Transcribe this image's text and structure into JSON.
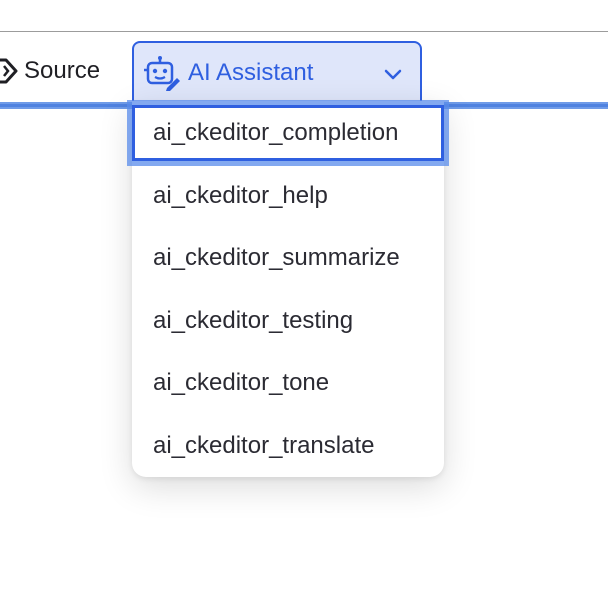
{
  "toolbar": {
    "source_label": "Source",
    "ai_assistant_label": "AI Assistant"
  },
  "icons": {
    "source": "source-code-icon",
    "ai": "robot-pencil-icon",
    "dropdown": "chevron-down-icon"
  },
  "colors": {
    "accent": "#2f5fe0",
    "accent_bg": "#dfe6fa",
    "focus_ring": "#6f9be8"
  },
  "menu": {
    "items": [
      {
        "label": "ai_ckeditor_completion",
        "active": true
      },
      {
        "label": "ai_ckeditor_help"
      },
      {
        "label": "ai_ckeditor_summarize"
      },
      {
        "label": "ai_ckeditor_testing"
      },
      {
        "label": "ai_ckeditor_tone"
      },
      {
        "label": "ai_ckeditor_translate"
      }
    ]
  }
}
